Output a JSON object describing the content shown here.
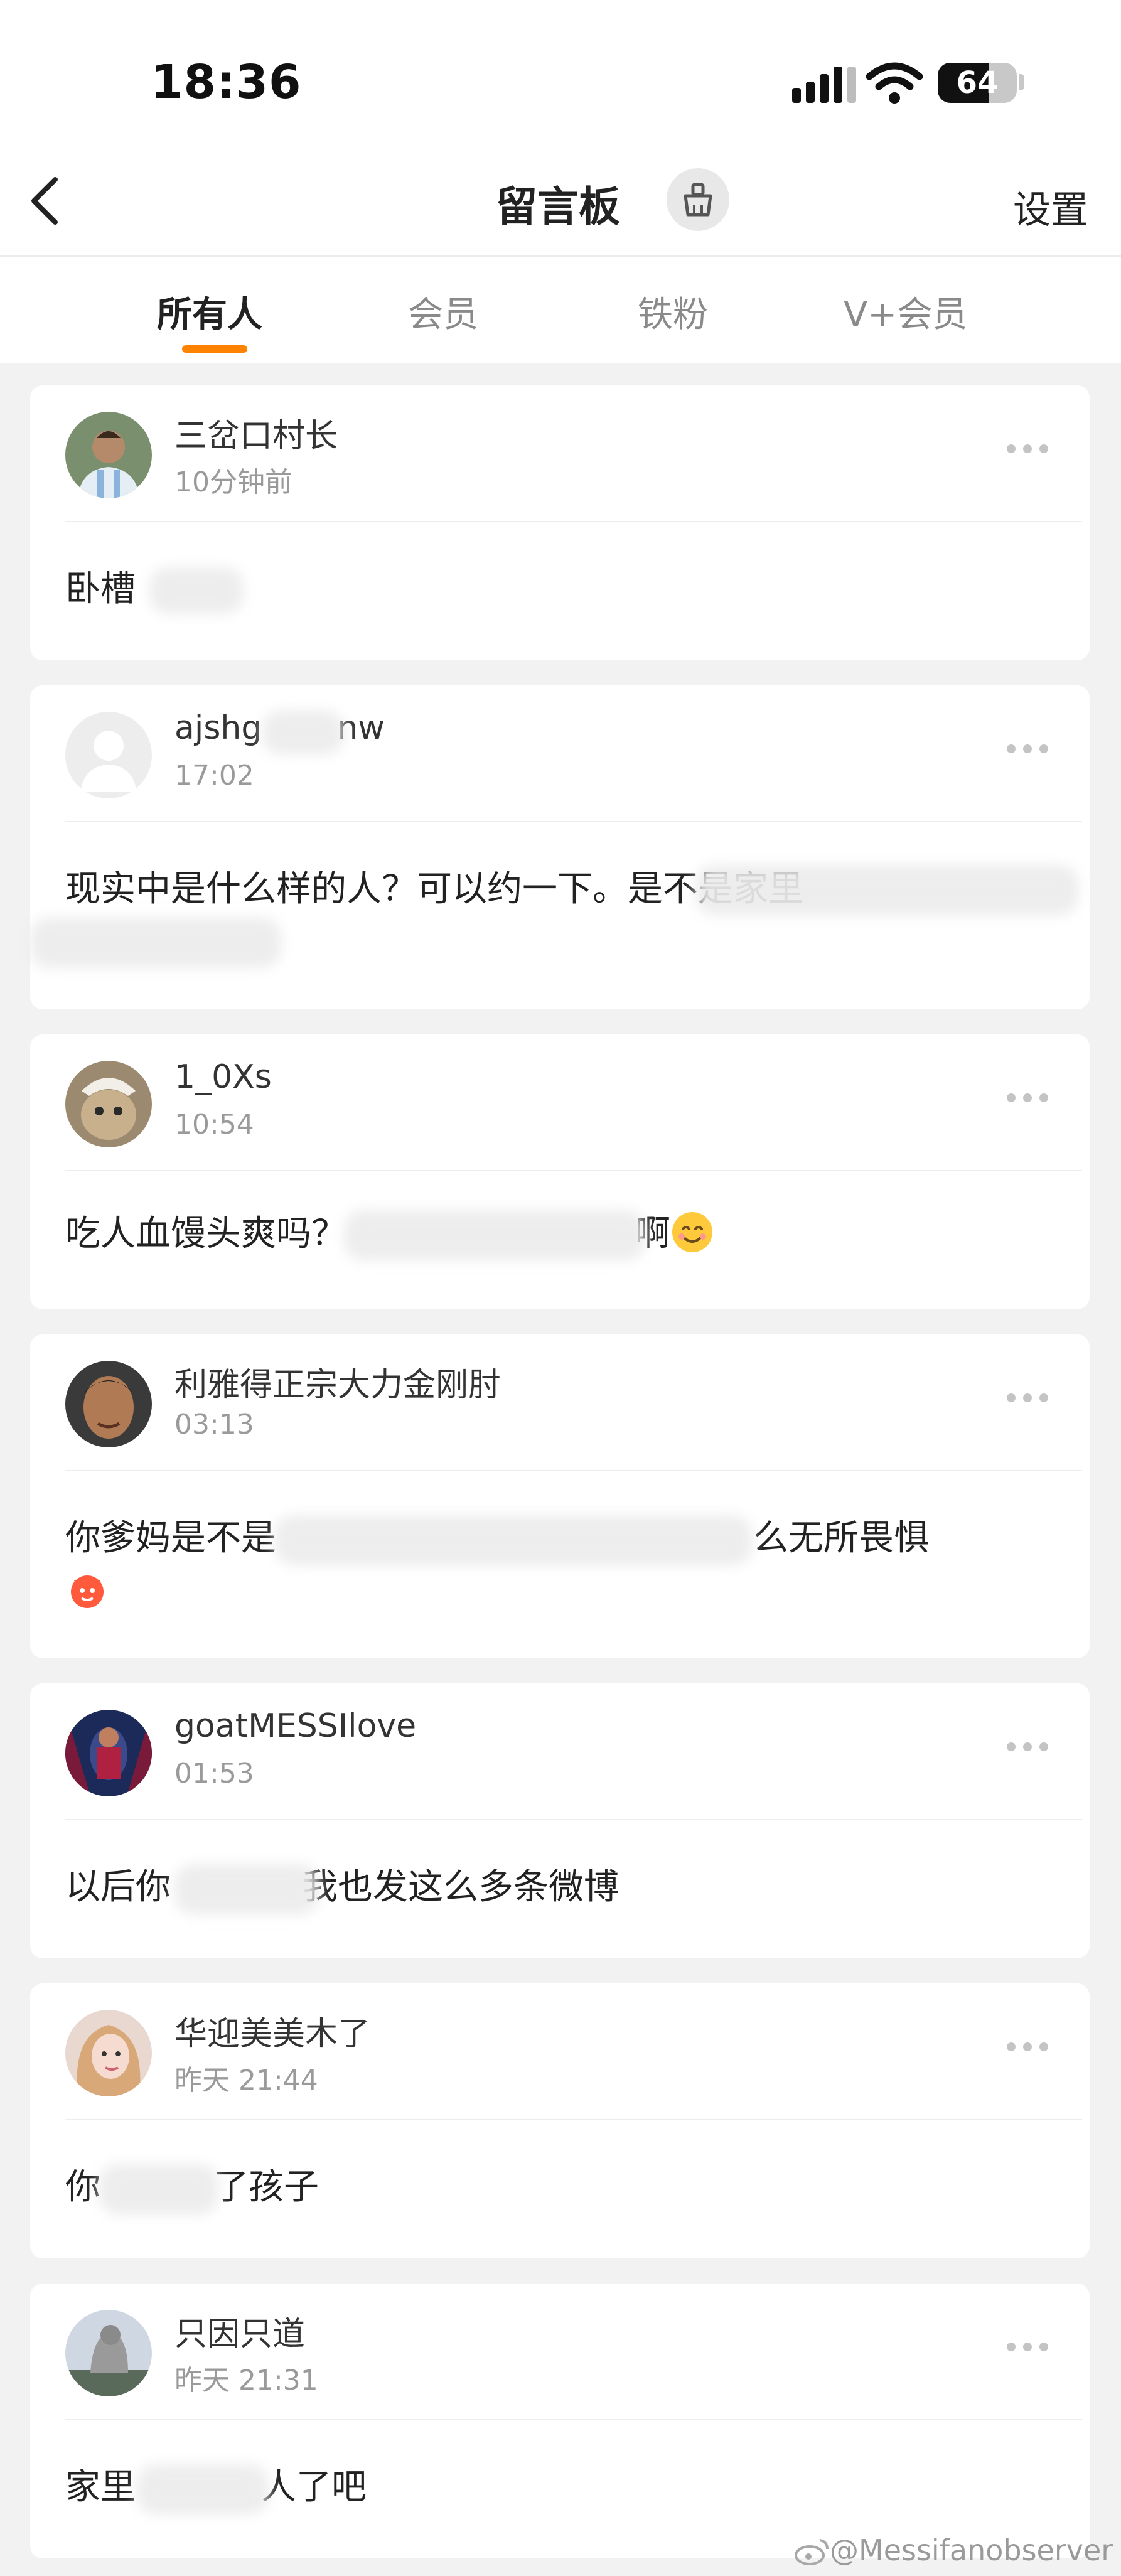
{
  "status_bar": {
    "time": "18:36",
    "battery_level": "64",
    "battery_fraction": 0.64,
    "signal_bars": 4,
    "icons": [
      "signal-icon",
      "wifi-icon",
      "battery-icon"
    ]
  },
  "nav": {
    "title": "留言板",
    "settings_label": "设置",
    "icons": [
      "back-icon",
      "broom-clean-icon"
    ]
  },
  "tabs": [
    {
      "label": "所有人",
      "active": true
    },
    {
      "label": "会员",
      "active": false
    },
    {
      "label": "铁粉",
      "active": false
    },
    {
      "label": "V+会员",
      "active": false
    }
  ],
  "colors": {
    "accent": "#ff8200",
    "background": "#f2f2f2",
    "card": "#ffffff",
    "secondary_text": "#9a9a9a"
  },
  "messages": [
    {
      "username": "三岔口村长",
      "time": "10分钟前",
      "content": "卧槽"
    },
    {
      "username": "ajshg",
      "username_end": "nw",
      "time": "17:02",
      "content": "现实中是什么样的人？可以约一下。是不是家里"
    },
    {
      "username": "1_0Xs",
      "time": "10:54",
      "content": "吃人血馒头爽吗？",
      "content_end": "啊"
    },
    {
      "username": "利雅得正宗大力金刚肘",
      "time": "03:13",
      "content": "你爹妈是不是",
      "content_end": "么无所畏惧"
    },
    {
      "username": "goatMESSIlove",
      "time": "01:53",
      "content": "以后你",
      "content_end": "我也发这么多条微博"
    },
    {
      "username": "华迎美美木了",
      "time": "昨天 21:44",
      "content": "你",
      "content_end": "了孩子"
    },
    {
      "username": "只因只道",
      "time": "昨天 21:31",
      "content": "家里",
      "content_end": "人了吧"
    }
  ],
  "watermark": "@Messifanobserver"
}
